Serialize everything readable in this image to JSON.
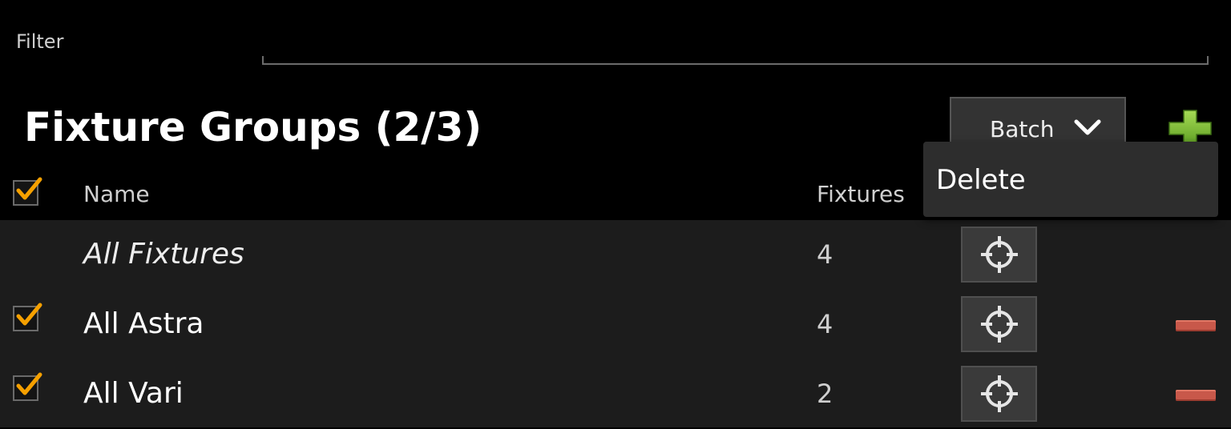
{
  "filter": {
    "label": "Filter",
    "value": ""
  },
  "title": "Fixture Groups (2/3)",
  "batch": {
    "label": "Batch",
    "icon": "chevron-down-icon"
  },
  "add_icon": "plus-icon",
  "header": {
    "name": "Name",
    "fixtures": "Fixtures",
    "select_all_checked": true
  },
  "dropdown": {
    "items": [
      "Delete"
    ]
  },
  "rows": [
    {
      "name": "All Fixtures",
      "count": "4",
      "checked": false,
      "italic": true,
      "removable": false
    },
    {
      "name": "All Astra",
      "count": "4",
      "checked": true,
      "italic": false,
      "removable": true
    },
    {
      "name": "All Vari",
      "count": "2",
      "checked": true,
      "italic": false,
      "removable": true
    }
  ],
  "colors": {
    "background": "#000000",
    "list_background": "#1c1c1c",
    "check_orange": "#f5a000",
    "add_green": "#7cc033",
    "remove_red": "#c8584a"
  }
}
